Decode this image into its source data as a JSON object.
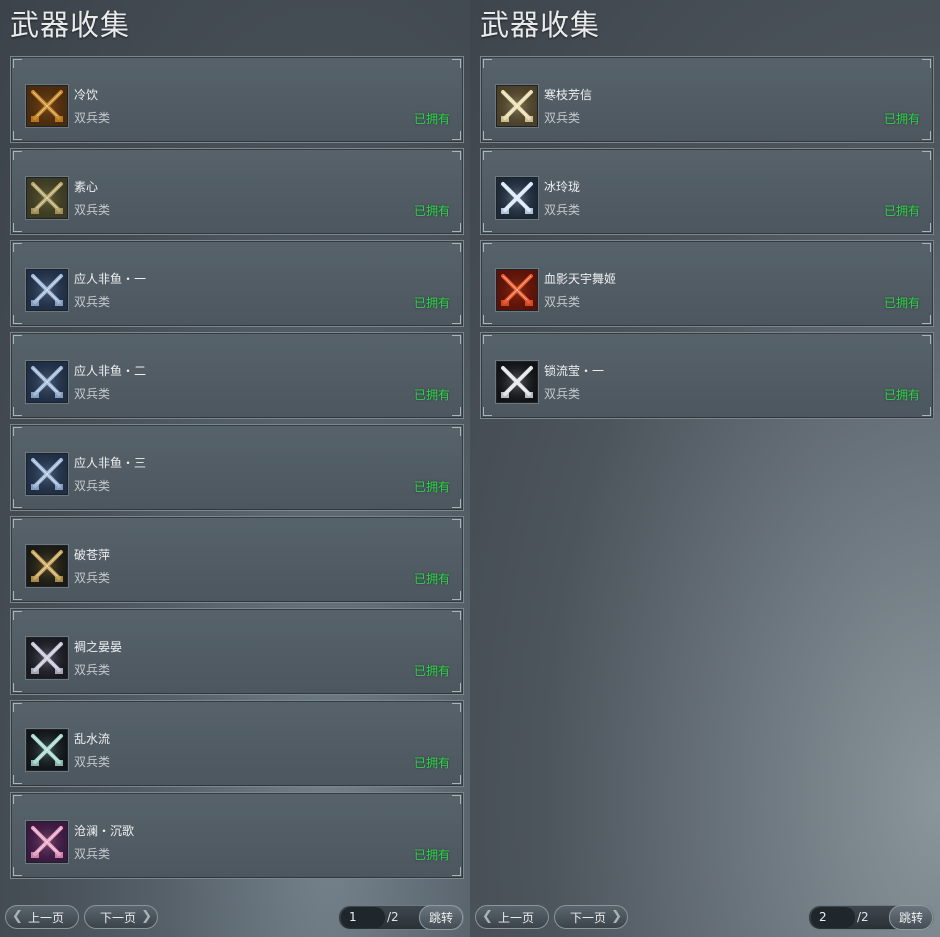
{
  "panels": [
    {
      "title": "武器收集",
      "items": [
        {
          "name": "冷饮",
          "type": "双兵类",
          "status": "已拥有",
          "icon": "golden-twin-blades-icon",
          "palette": [
            "#4a2b0e",
            "#c9892a"
          ]
        },
        {
          "name": "素心",
          "type": "双兵类",
          "status": "已拥有",
          "icon": "olive-twin-blades-icon",
          "palette": [
            "#3a3a22",
            "#b5a46a"
          ]
        },
        {
          "name": "应人非鱼・一",
          "type": "双兵类",
          "status": "已拥有",
          "icon": "steel-blue-twin-blades-icon",
          "palette": [
            "#1f2e44",
            "#9fb8d8"
          ]
        },
        {
          "name": "应人非鱼・二",
          "type": "双兵类",
          "status": "已拥有",
          "icon": "steel-blue-twin-blades-icon",
          "palette": [
            "#1f2e44",
            "#9fb8d8"
          ]
        },
        {
          "name": "应人非鱼・三",
          "type": "双兵类",
          "status": "已拥有",
          "icon": "steel-blue-twin-blades-icon",
          "palette": [
            "#1f2e44",
            "#9fb8d8"
          ]
        },
        {
          "name": "破苍萍",
          "type": "双兵类",
          "status": "已拥有",
          "icon": "gold-dark-twin-blades-icon",
          "palette": [
            "#1a1a14",
            "#c8a45a"
          ]
        },
        {
          "name": "裯之晏晏",
          "type": "双兵类",
          "status": "已拥有",
          "icon": "silver-violet-twin-blades-icon",
          "palette": [
            "#181a20",
            "#c8c4d8"
          ]
        },
        {
          "name": "乱水流",
          "type": "双兵类",
          "status": "已拥有",
          "icon": "jade-serpent-blades-icon",
          "palette": [
            "#101418",
            "#a8d8d0"
          ]
        },
        {
          "name": "沧澜・沉歌",
          "type": "双兵类",
          "status": "已拥有",
          "icon": "pink-gold-twin-blades-icon",
          "palette": [
            "#3a1840",
            "#e8a0c0"
          ]
        }
      ],
      "footer": {
        "prev": "上一页",
        "next": "下一页",
        "page": "1",
        "total": "/2",
        "jump": "跳转"
      }
    },
    {
      "title": "武器收集",
      "items": [
        {
          "name": "寒枝芳信",
          "type": "双兵类",
          "status": "已拥有",
          "icon": "pale-gold-twin-blades-icon",
          "palette": [
            "#4a4028",
            "#e8dcb0"
          ]
        },
        {
          "name": "冰玲珑",
          "type": "双兵类",
          "status": "已拥有",
          "icon": "ice-star-blades-icon",
          "palette": [
            "#1c2838",
            "#d8e8f8"
          ]
        },
        {
          "name": "血影天宇舞姬",
          "type": "双兵类",
          "status": "已拥有",
          "icon": "crimson-fan-blades-icon",
          "palette": [
            "#5a1208",
            "#e8582a"
          ]
        },
        {
          "name": "锁流莹・一",
          "type": "双兵类",
          "status": "已拥有",
          "icon": "silver-twin-blades-icon",
          "palette": [
            "#101214",
            "#e0e4e8"
          ]
        }
      ],
      "footer": {
        "prev": "上一页",
        "next": "下一页",
        "page": "2",
        "total": "/2",
        "jump": "跳转"
      }
    }
  ]
}
